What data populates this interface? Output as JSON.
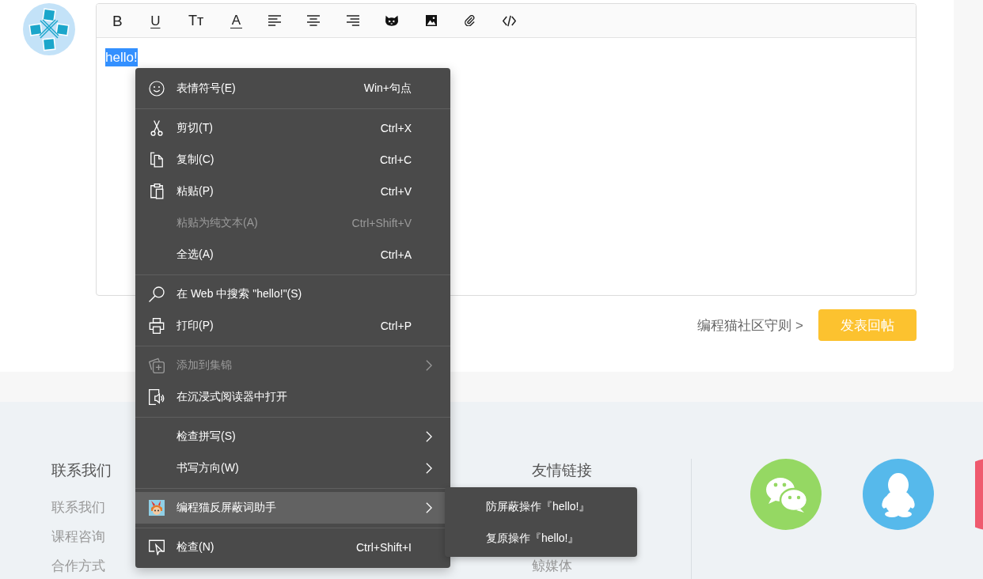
{
  "editor": {
    "toolbar": [
      {
        "kind": "bold",
        "label": "B"
      },
      {
        "kind": "underline",
        "label": "U"
      },
      {
        "kind": "font-size",
        "label": "Tᴛ"
      },
      {
        "kind": "font-color",
        "label": "A"
      },
      {
        "kind": "align-left"
      },
      {
        "kind": "align-center"
      },
      {
        "kind": "align-right"
      },
      {
        "kind": "emoji"
      },
      {
        "kind": "image"
      },
      {
        "kind": "attachment"
      },
      {
        "kind": "code"
      }
    ],
    "content": {
      "text": "hello!",
      "selected": true
    }
  },
  "actions": {
    "rules_link": "编程猫社区守则 >",
    "submit_button": "发表回帖"
  },
  "context_menu": {
    "sections": [
      [
        {
          "label": "表情符号(E)",
          "shortcut": "Win+句点",
          "disabled": false,
          "highlighted": false,
          "has_submenu": false
        }
      ],
      [
        {
          "label": "剪切(T)",
          "shortcut": "Ctrl+X",
          "disabled": false,
          "highlighted": false,
          "has_submenu": false
        },
        {
          "label": "复制(C)",
          "shortcut": "Ctrl+C",
          "disabled": false,
          "highlighted": false,
          "has_submenu": false
        },
        {
          "label": "粘贴(P)",
          "shortcut": "Ctrl+V",
          "disabled": false,
          "highlighted": false,
          "has_submenu": false
        },
        {
          "label": "粘贴为纯文本(A)",
          "shortcut": "Ctrl+Shift+V",
          "disabled": true,
          "highlighted": false,
          "has_submenu": false
        },
        {
          "label": "全选(A)",
          "shortcut": "Ctrl+A",
          "disabled": false,
          "highlighted": false,
          "has_submenu": false
        }
      ],
      [
        {
          "label": "在 Web 中搜索 \"hello!\"(S)",
          "disabled": false,
          "highlighted": false,
          "has_submenu": false
        },
        {
          "label": "打印(P)",
          "shortcut": "Ctrl+P",
          "disabled": false,
          "highlighted": false,
          "has_submenu": false
        }
      ],
      [
        {
          "label": "添加到集锦",
          "disabled": true,
          "highlighted": false,
          "has_submenu": true
        },
        {
          "label": "在沉浸式阅读器中打开",
          "disabled": false,
          "highlighted": false,
          "has_submenu": false
        }
      ],
      [
        {
          "label": "检查拼写(S)",
          "disabled": false,
          "highlighted": false,
          "has_submenu": true
        },
        {
          "label": "书写方向(W)",
          "disabled": false,
          "highlighted": false,
          "has_submenu": true
        }
      ],
      [
        {
          "label": "编程猫反屏蔽词助手",
          "disabled": false,
          "highlighted": true,
          "has_submenu": true,
          "submenu": [
            {
              "label": "防屏蔽操作『hello!』"
            },
            {
              "label": "复原操作『hello!』"
            }
          ]
        }
      ],
      [
        {
          "label": "检查(N)",
          "shortcut": "Ctrl+Shift+I",
          "disabled": false,
          "highlighted": false,
          "has_submenu": false
        }
      ]
    ]
  },
  "footer": {
    "columns": [
      {
        "heading": "联系我们",
        "links": [
          "联系我们",
          "课程咨询",
          "合作方式"
        ]
      },
      {
        "heading": "友情链接",
        "links": [
          "鲸媒体"
        ]
      }
    ]
  }
}
